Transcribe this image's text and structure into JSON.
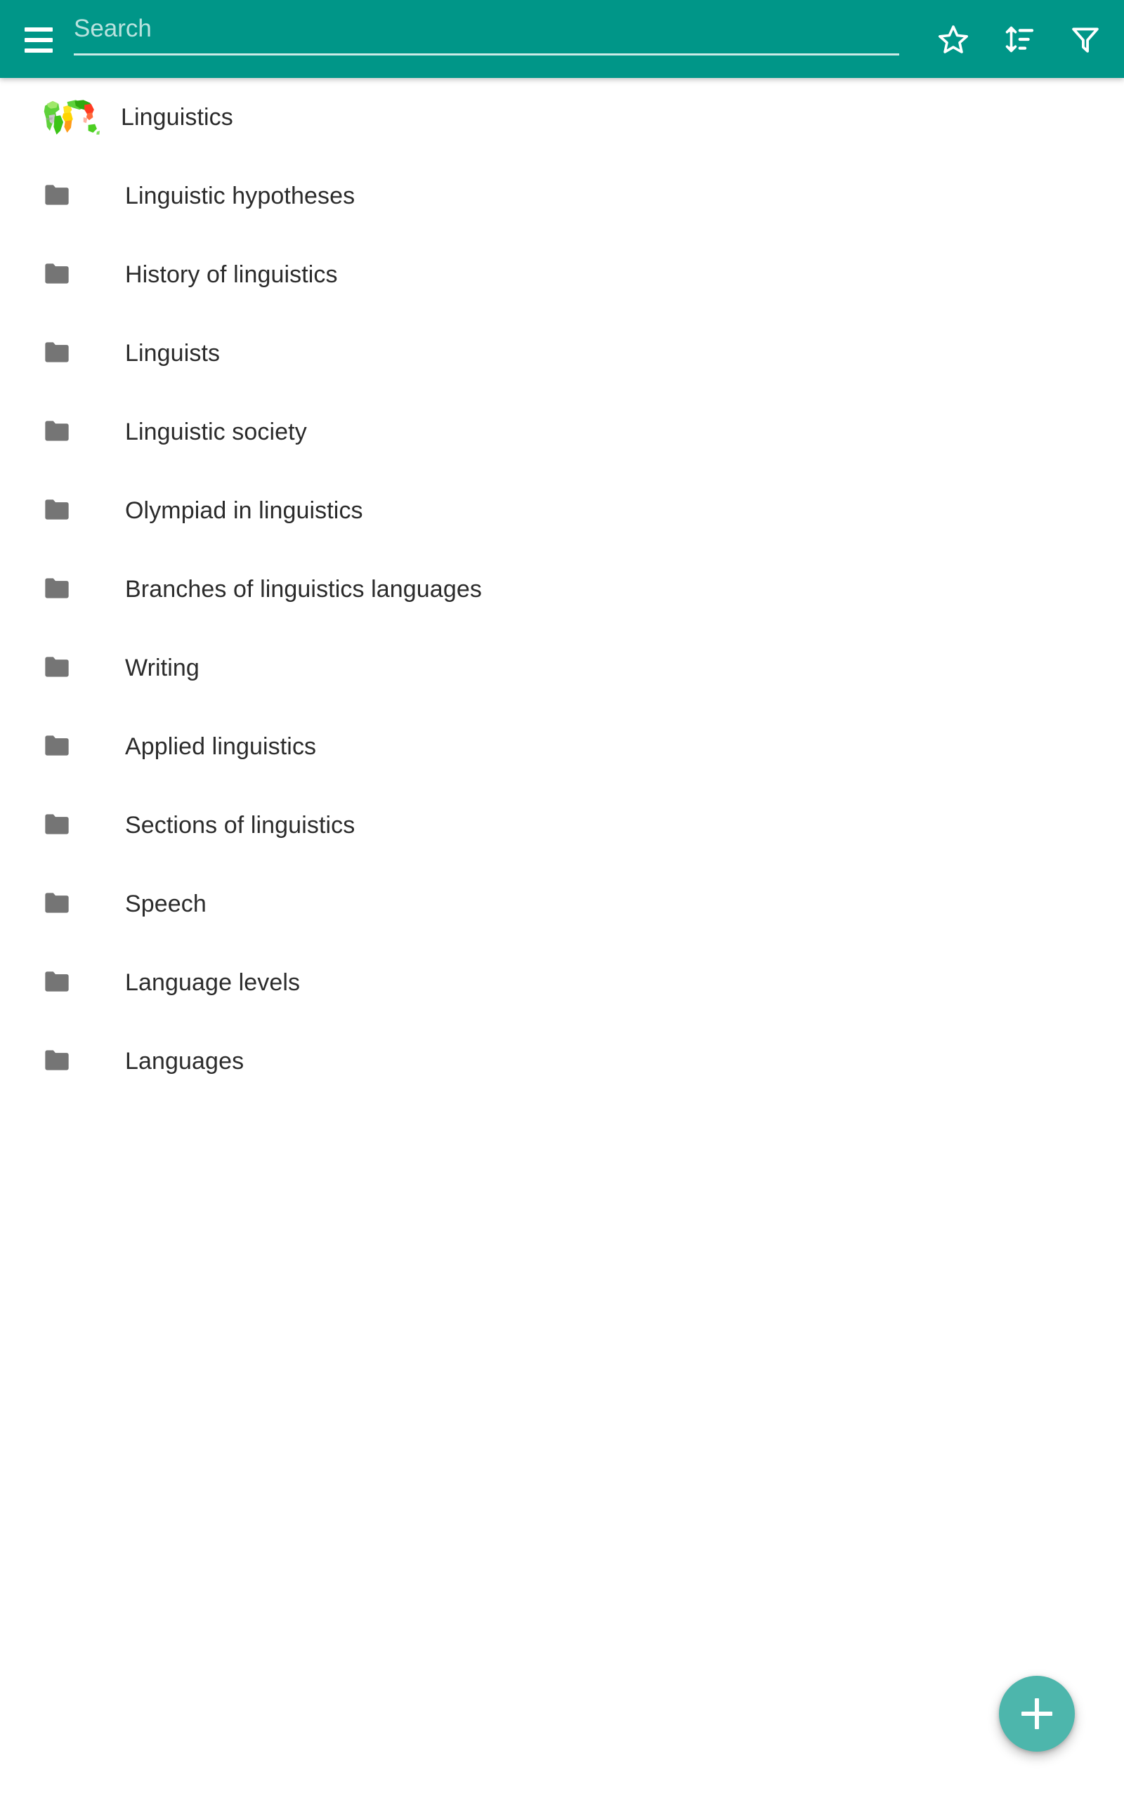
{
  "appbar": {
    "menu_icon": "hamburger-menu-icon",
    "search": {
      "value": "",
      "placeholder": "Search"
    },
    "actions": [
      {
        "name": "favorites-button",
        "icon": "star-outline-icon",
        "label": "Favorites"
      },
      {
        "name": "sort-button",
        "icon": "sort-icon",
        "label": "Sort"
      },
      {
        "name": "filter-button",
        "icon": "filter-funnel-icon",
        "label": "Filter"
      }
    ],
    "colors": {
      "background": "#009688",
      "foreground": "#ffffff"
    }
  },
  "list": {
    "items": [
      {
        "label": "Linguistics",
        "icon": "world-map-icon",
        "featured": true
      },
      {
        "label": "Linguistic hypotheses",
        "icon": "folder-icon",
        "featured": false
      },
      {
        "label": "History of linguistics",
        "icon": "folder-icon",
        "featured": false
      },
      {
        "label": "Linguists",
        "icon": "folder-icon",
        "featured": false
      },
      {
        "label": "Linguistic society",
        "icon": "folder-icon",
        "featured": false
      },
      {
        "label": "Olympiad in linguistics",
        "icon": "folder-icon",
        "featured": false
      },
      {
        "label": "Branches of linguistics languages",
        "icon": "folder-icon",
        "featured": false
      },
      {
        "label": "Writing",
        "icon": "folder-icon",
        "featured": false
      },
      {
        "label": "Applied linguistics",
        "icon": "folder-icon",
        "featured": false
      },
      {
        "label": "Sections of linguistics",
        "icon": "folder-icon",
        "featured": false
      },
      {
        "label": "Speech",
        "icon": "folder-icon",
        "featured": false
      },
      {
        "label": "Language levels",
        "icon": "folder-icon",
        "featured": false
      },
      {
        "label": "Languages",
        "icon": "folder-icon",
        "featured": false
      }
    ],
    "colors": {
      "folder": "#757575",
      "text": "#2b2b2b",
      "background": "#ffffff"
    }
  },
  "fab": {
    "icon": "plus-icon",
    "label": "Add",
    "color": "#4db6ac"
  }
}
